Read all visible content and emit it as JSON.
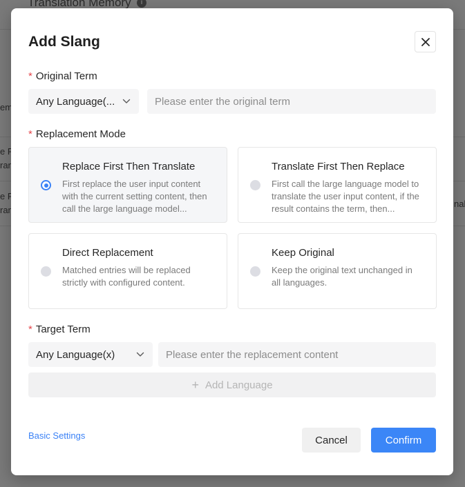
{
  "background": {
    "page_title": "Translation Memory",
    "fragments_left": [
      "em",
      "e F",
      "ran",
      "e F",
      "ran"
    ],
    "fragment_right": "nal"
  },
  "modal": {
    "title": "Add Slang",
    "original_term": {
      "label": "Original Term",
      "required_mark": "*",
      "language_select": "Any Language(...",
      "input_placeholder": "Please enter the original term",
      "input_value": ""
    },
    "replacement_mode": {
      "label": "Replacement Mode",
      "required_mark": "*",
      "options": [
        {
          "title": "Replace First Then Translate",
          "description": "First replace the user input content with the current setting content, then call the large language model...",
          "selected": true
        },
        {
          "title": "Translate First Then Replace",
          "description": "First call the large language model to translate the user input content, if the result contains the term, then...",
          "selected": false
        },
        {
          "title": "Direct Replacement",
          "description": "Matched entries will be replaced strictly with configured content.",
          "selected": false
        },
        {
          "title": "Keep Original",
          "description": "Keep the original text unchanged in all languages.",
          "selected": false
        }
      ]
    },
    "target_term": {
      "label": "Target Term",
      "required_mark": "*",
      "language_select": "Any Language(x)",
      "input_placeholder": "Please enter the replacement content",
      "input_value": ""
    },
    "add_language": {
      "icon": "plus-icon",
      "label": "Add Language"
    },
    "basic_settings_link": "Basic Settings",
    "cancel_label": "Cancel",
    "confirm_label": "Confirm"
  },
  "colors": {
    "accent": "#3b86f7",
    "required": "#e5484d",
    "link": "#3b82f6"
  }
}
